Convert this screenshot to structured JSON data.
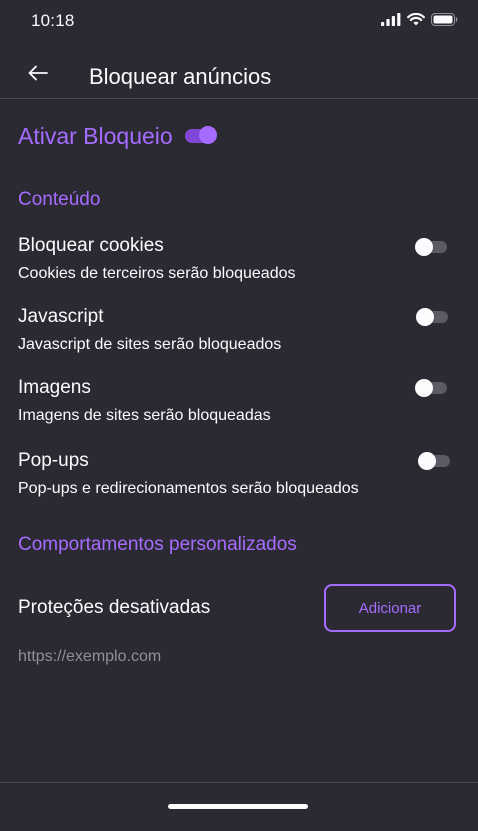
{
  "status_bar": {
    "time": "10:18",
    "icons": [
      "cellular-signal-icon",
      "wifi-icon",
      "battery-icon"
    ]
  },
  "toolbar": {
    "back_icon": "back-arrow-icon",
    "title": "Bloquear anúncios"
  },
  "master": {
    "label": "Ativar Bloqueio",
    "enabled": true
  },
  "content_section": {
    "title": "Conteúdo",
    "items": [
      {
        "title": "Bloquear cookies",
        "description": "Cookies de terceiros serão bloqueados",
        "enabled": false
      },
      {
        "title": "Javascript",
        "description": "Javascript de sites serão bloqueados",
        "enabled": false
      },
      {
        "title": "Imagens",
        "description": "Imagens de sites serão bloqueadas",
        "enabled": false
      },
      {
        "title": "Pop-ups",
        "description": "Pop-ups e redirecionamentos serão bloqueados",
        "enabled": false
      }
    ]
  },
  "custom_section": {
    "title": "Comportamentos personalizados",
    "protections_label": "Proteções desativadas",
    "add_button": "Adicionar",
    "example_url": "https://exemplo.com"
  },
  "colors": {
    "background": "#2b2a33",
    "accent": "#a66cff",
    "text": "#fbfbfe",
    "muted_text": "#8f8f9d",
    "toggle_off_track": "#5b5b66"
  }
}
